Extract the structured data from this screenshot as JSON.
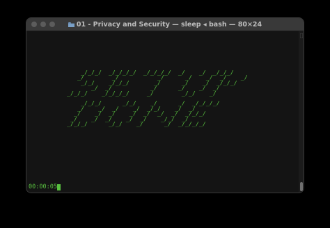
{
  "window": {
    "title": "01 - Privacy and Security — sleep ◂ bash — 80×24",
    "folder_icon": "folder-icon"
  },
  "terminal": {
    "ascii_art": "    _/_/_/  _/_/_/_/  _/_/_/_/  _/    _/  _/_/_/\n   _/        _/           _/      _/    _/  _/    _/\n    _/_/    _/_/_/       _/      _/    _/  _/_/_/\n       _/  _/           _/      _/    _/  _/\n_/_/_/    _/_/_/_/     _/        _/_/    _/\n\n    _/_/_/      _/_/    _/      _/  _/_/_/_/\n   _/    _/  _/    _/  _/_/    _/  _/\n  _/    _/  _/    _/  _/  _/  _/  _/_/_/\n _/    _/  _/    _/  _/    _/_/  _/\n_/_/_/      _/_/    _/      _/  _/_/_/_/",
    "timer": "00:00:05"
  },
  "colors": {
    "terminal_bg": "#141414",
    "text_green": "#58c23f",
    "titlebar": "#393939"
  }
}
